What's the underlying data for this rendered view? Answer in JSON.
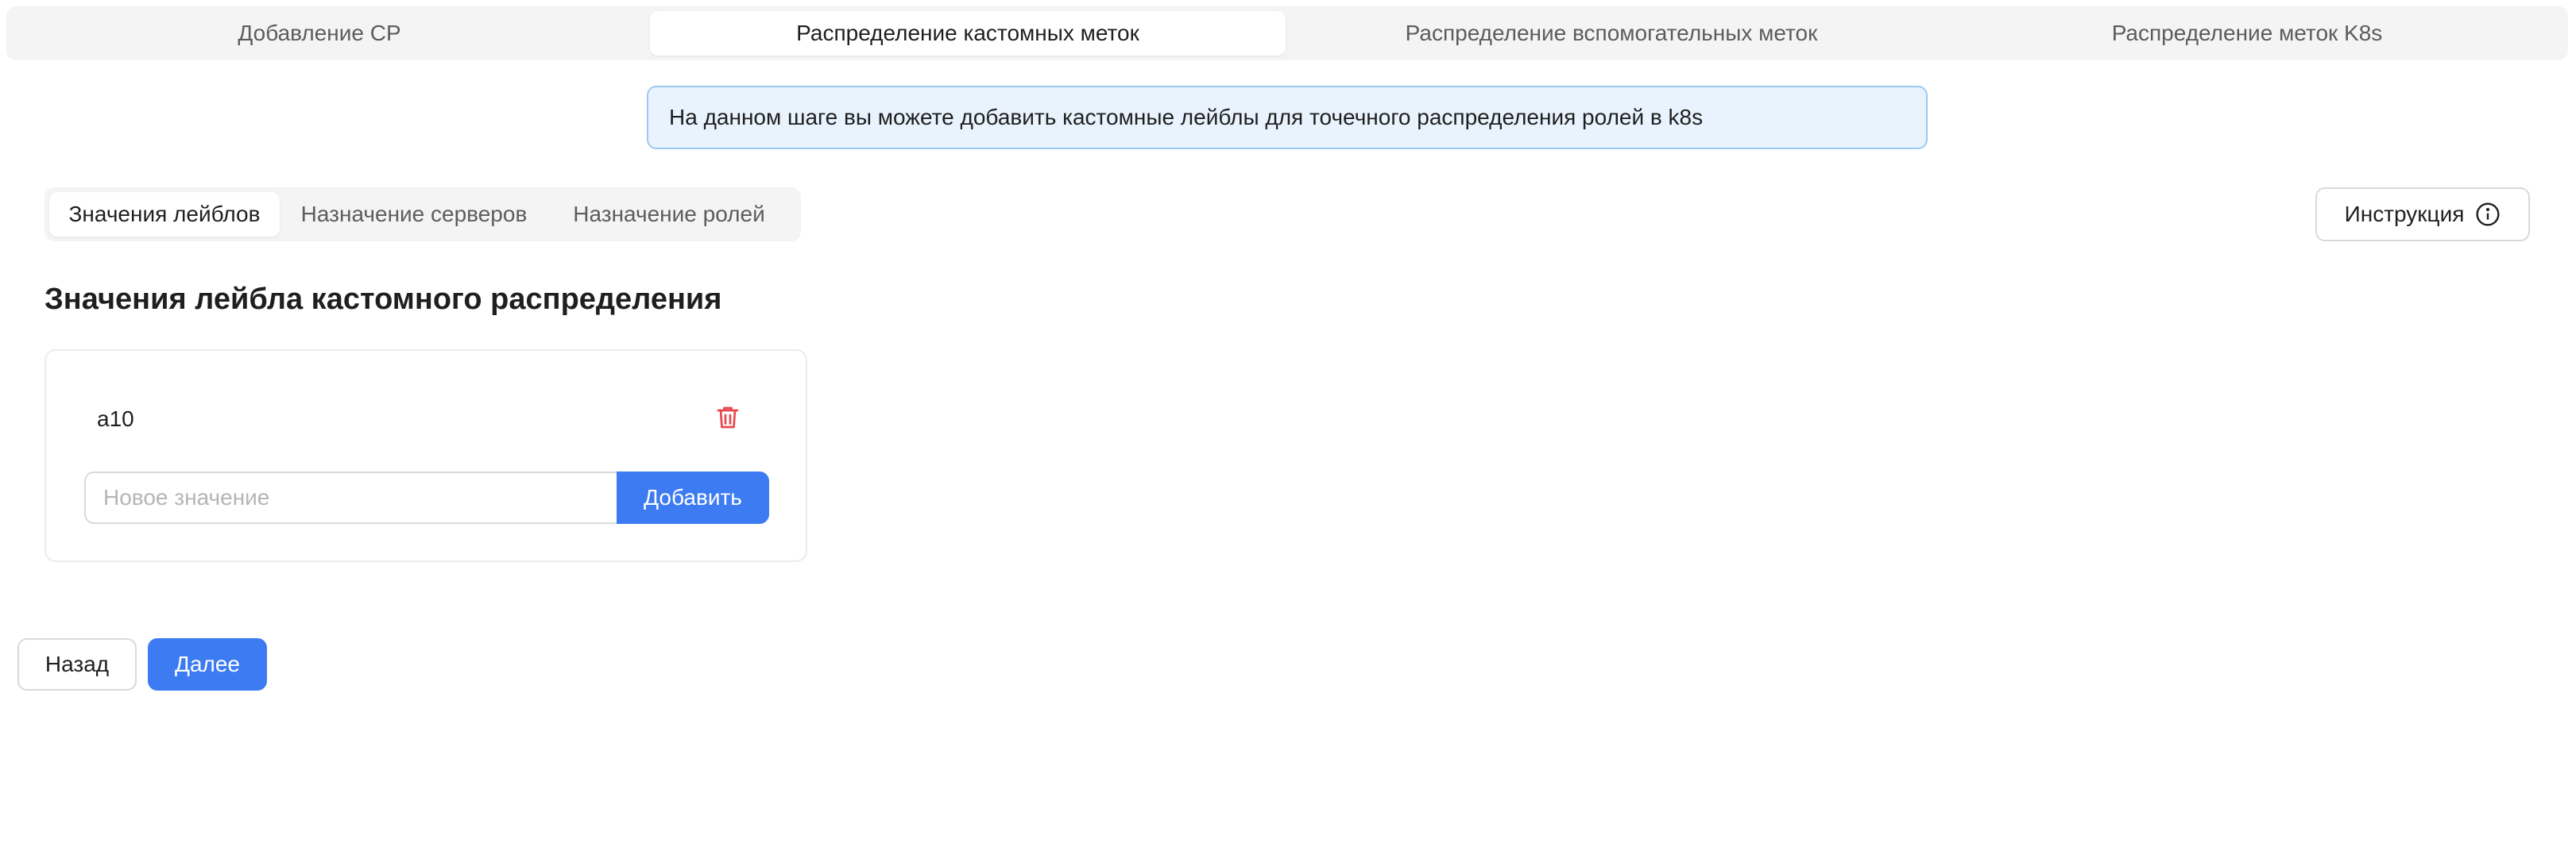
{
  "steps": [
    {
      "label": "Добавление СР"
    },
    {
      "label": "Распределение кастомных меток"
    },
    {
      "label": "Распределение вспомогательных меток"
    },
    {
      "label": "Распределение меток K8s"
    }
  ],
  "info_banner": "На данном шаге вы можете добавить кастомные лейблы для точечного распределения ролей в k8s",
  "subtabs": [
    {
      "label": "Значения лейблов"
    },
    {
      "label": "Назначение серверов"
    },
    {
      "label": "Назначение ролей"
    }
  ],
  "instruction_button": {
    "label": "Инструкция",
    "icon": "info-circle-icon"
  },
  "section_title": "Значения лейбла кастомного распределения",
  "values": [
    {
      "label": "a10",
      "delete_icon": "trash-icon"
    }
  ],
  "new_value": {
    "value": "",
    "placeholder": "Новое значение",
    "add_label": "Добавить"
  },
  "footer": {
    "back_label": "Назад",
    "next_label": "Далее"
  },
  "colors": {
    "accent": "#3d7bf2",
    "danger": "#e5484d",
    "info_bg": "#e8f3fd",
    "info_border": "#9cc9f2"
  }
}
